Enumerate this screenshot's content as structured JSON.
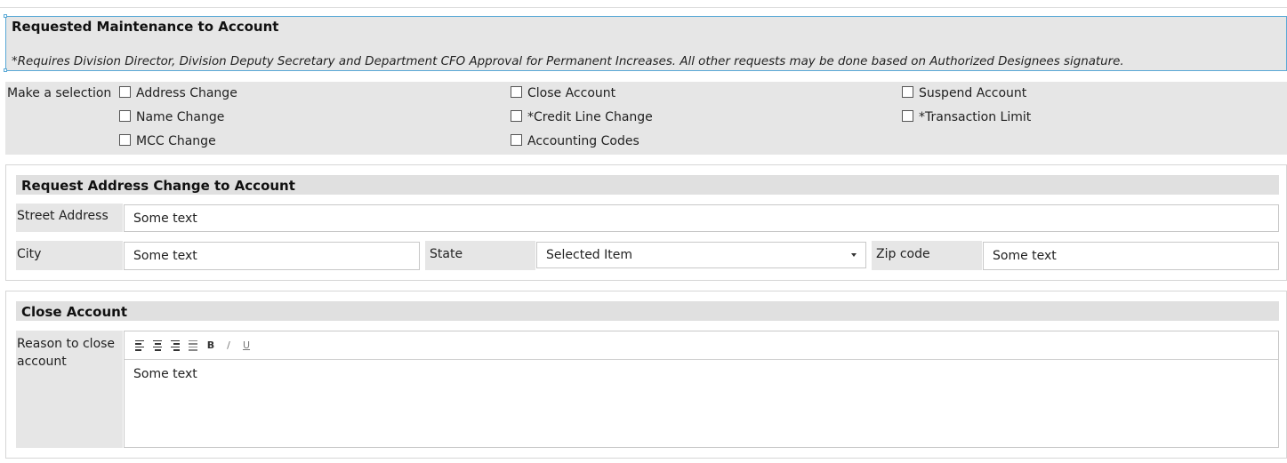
{
  "header": {
    "title": "Requested Maintenance to Account",
    "note": "*Requires Division Director, Division Deputy Secretary and Department CFO Approval for Permanent Increases. All other requests may be done based on Authorized Designees signature."
  },
  "selection": {
    "label": "Make a selection",
    "options": {
      "address_change": "Address Change",
      "name_change": "Name Change",
      "mcc_change": "MCC Change",
      "close_account": "Close Account",
      "credit_line_change": "*Credit Line Change",
      "accounting_codes": "Accounting Codes",
      "suspend_account": "Suspend Account",
      "transaction_limit": "*Transaction Limit"
    }
  },
  "address_section": {
    "title": "Request Address Change to Account",
    "street_label": "Street Address",
    "street_value": "Some text",
    "city_label": "City",
    "city_value": "Some text",
    "state_label": "State",
    "state_value": "Selected Item",
    "zip_label": "Zip code",
    "zip_value": "Some text"
  },
  "close_section": {
    "title": "Close Account",
    "reason_label": "Reason to close account",
    "reason_value": "Some text",
    "toolbar": {
      "bold": "B",
      "italic": "/",
      "underline": "U"
    }
  },
  "colors": {
    "panel_bg": "#e6e6e6",
    "selection_border": "#5aa9d6"
  }
}
